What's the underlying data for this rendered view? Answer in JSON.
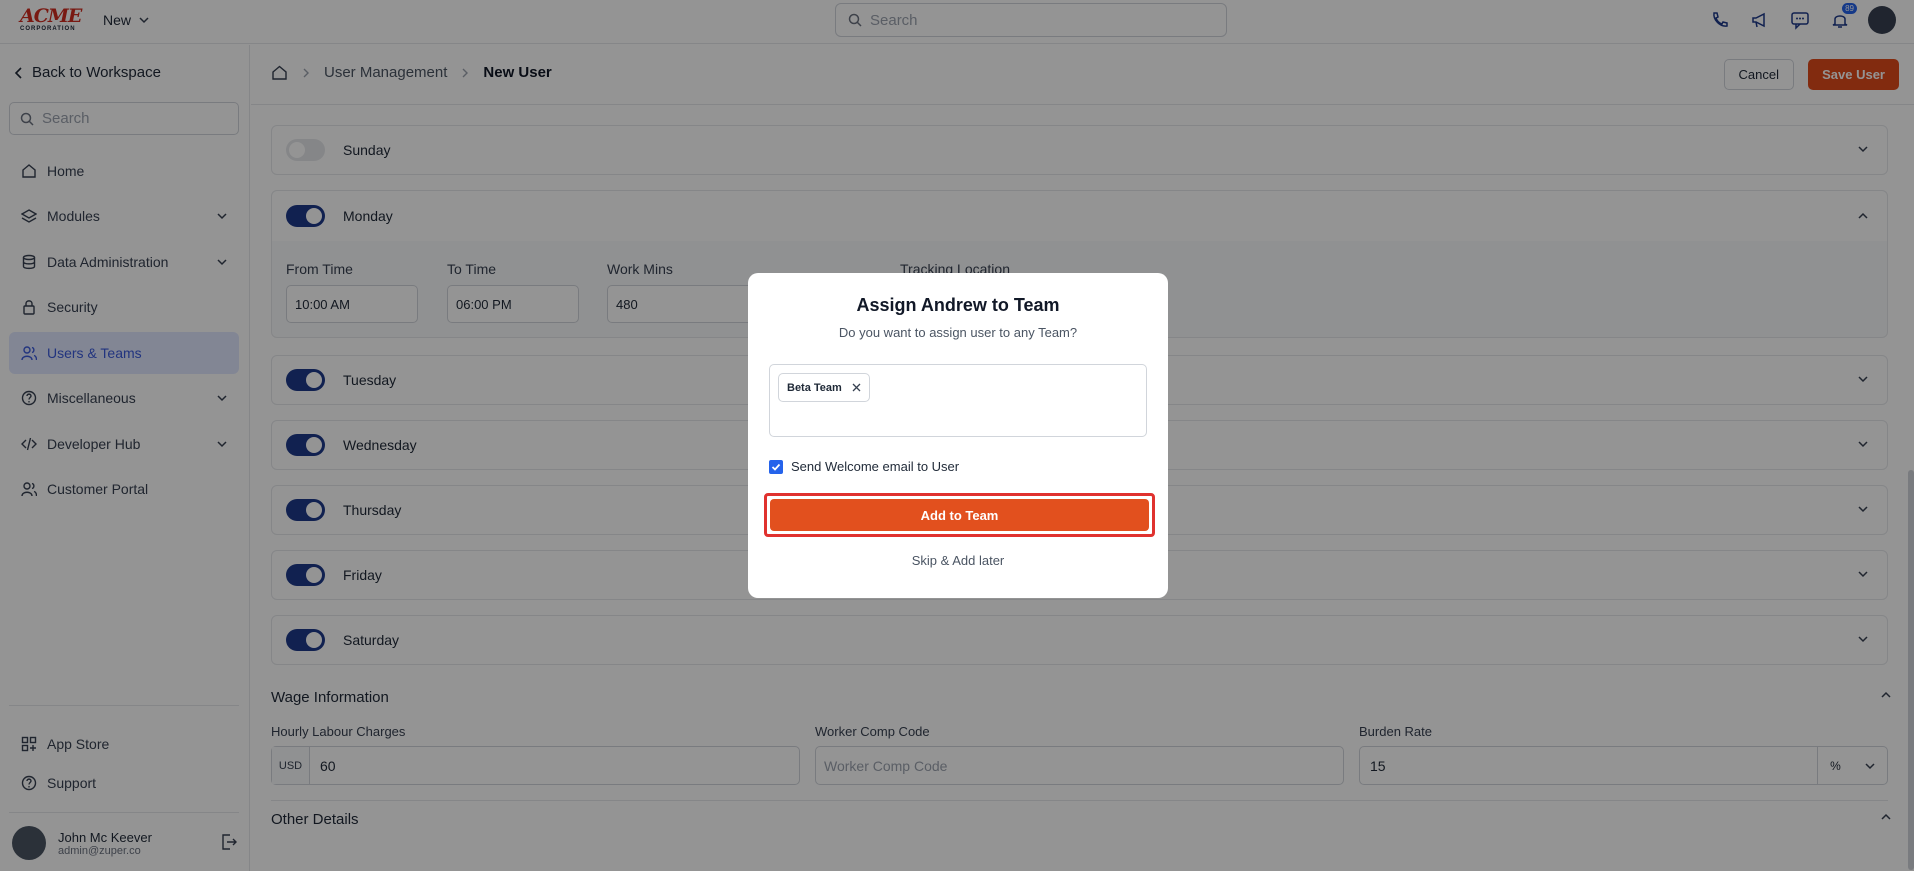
{
  "topbar": {
    "logo_line1": "ACME",
    "logo_line2": "CORPORATION",
    "new_label": "New",
    "search_placeholder": "Search",
    "notification_count": "89"
  },
  "sidebar": {
    "back_label": "Back to Workspace",
    "search_placeholder": "Search",
    "items": [
      {
        "label": "Home"
      },
      {
        "label": "Modules"
      },
      {
        "label": "Data Administration"
      },
      {
        "label": "Security"
      },
      {
        "label": "Users & Teams"
      },
      {
        "label": "Miscellaneous"
      },
      {
        "label": "Developer Hub"
      },
      {
        "label": "Customer Portal"
      }
    ],
    "bottom_items": [
      {
        "label": "App Store"
      },
      {
        "label": "Support"
      }
    ],
    "user": {
      "name": "John Mc Keever",
      "email": "admin@zuper.co"
    }
  },
  "header": {
    "crumb1": "User Management",
    "crumb2": "New User",
    "cancel_label": "Cancel",
    "save_label": "Save User"
  },
  "work_hours": {
    "days": [
      "Sunday",
      "Monday",
      "Tuesday",
      "Wednesday",
      "Thursday",
      "Friday",
      "Saturday"
    ],
    "enabled": [
      false,
      true,
      true,
      true,
      true,
      true,
      true
    ],
    "monday_fields": {
      "from_label": "From Time",
      "from_value": "10:00 AM",
      "to_label": "To Time",
      "to_value": "06:00 PM",
      "mins_label": "Work Mins",
      "mins_value": "480",
      "tracking_label": "Tracking Location"
    }
  },
  "wage": {
    "title": "Wage Information",
    "hourly_label": "Hourly Labour Charges",
    "currency": "USD",
    "hourly_value": "60",
    "comp_label": "Worker Comp Code",
    "comp_placeholder": "Worker Comp Code",
    "burden_label": "Burden Rate",
    "burden_value": "15",
    "burden_unit": "%"
  },
  "other": {
    "title": "Other Details"
  },
  "modal": {
    "title": "Assign Andrew to Team",
    "subtitle": "Do you want to assign user to any Team?",
    "chip_label": "Beta Team",
    "checkbox_label": "Send Welcome email to User",
    "checkbox_checked": true,
    "add_label": "Add to Team",
    "skip_label": "Skip & Add later"
  },
  "colors": {
    "accent": "#e2501e",
    "toggle_on": "#1e3a8a",
    "active_nav": "#e0e7ff",
    "highlight": "#e0322f"
  }
}
